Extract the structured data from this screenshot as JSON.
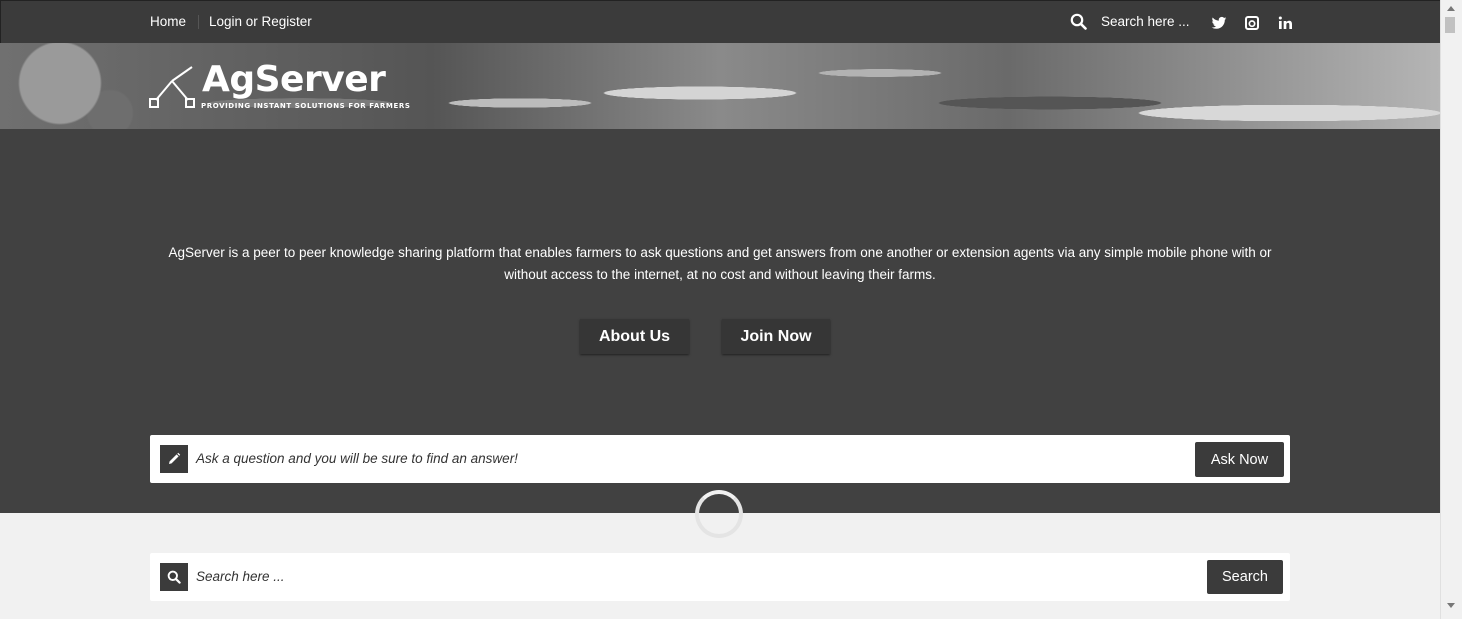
{
  "topbar": {
    "home_label": "Home",
    "login_label": "Login or Register",
    "search_placeholder": "Search here ...",
    "social_icons": [
      "twitter-icon",
      "instagram-icon",
      "linkedin-icon"
    ]
  },
  "header": {
    "logo_title": "AgServer",
    "logo_tagline": "PROVIDING INSTANT SOLUTIONS FOR FARMERS"
  },
  "hero": {
    "description": "AgServer is a peer to peer knowledge sharing platform that enables farmers to ask questions and get answers from one another or extension agents via any simple mobile phone with or without access to the internet, at no cost and without leaving their farms.",
    "about_label": "About Us",
    "join_label": "Join Now"
  },
  "ask": {
    "icon": "pencil-icon",
    "placeholder": "Ask a question and you will be sure to find an answer!",
    "button_label": "Ask Now"
  },
  "search": {
    "icon": "search-icon",
    "placeholder": "Search here ...",
    "button_label": "Search"
  },
  "colors": {
    "topbar_bg": "#3b3b3b",
    "hero_bg": "#414141",
    "button_bg": "#3b3b3b",
    "page_bg": "#f1f1f1"
  }
}
